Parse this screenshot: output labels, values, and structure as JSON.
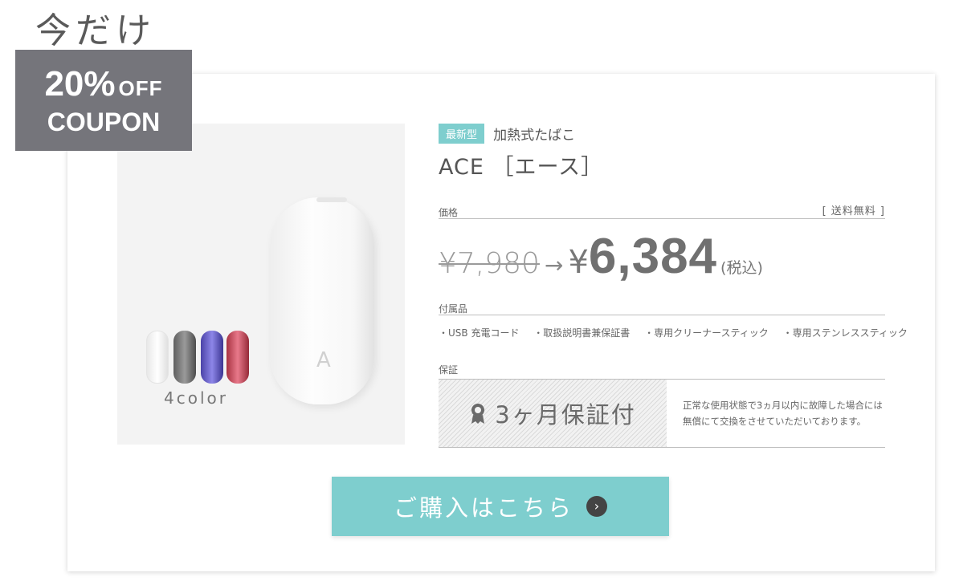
{
  "promo": {
    "label": "今だけ",
    "coupon_percent": "20%",
    "coupon_off": "OFF",
    "coupon_word": "COUPON"
  },
  "product": {
    "new_tag": "最新型",
    "category": "加熱式たばこ",
    "name": "ACE ［エース］",
    "device_logo": "A",
    "color_count_label": "4color",
    "swatch_colors": [
      "#ffffff",
      "#7a7a7a",
      "#6a62d0",
      "#d05060"
    ]
  },
  "price": {
    "section_label": "価格",
    "shipping": "[ 送料無料 ]",
    "old_price": "¥7,980",
    "arrow": "→",
    "yen_symbol": "¥",
    "new_price": "6,384",
    "tax_note": "(税込)"
  },
  "accessories": {
    "section_label": "付属品",
    "items": [
      "・USB 充電コード",
      "・取扱説明書兼保証書",
      "・専用クリーナースティック",
      "・専用ステンレススティック"
    ]
  },
  "warranty": {
    "section_label": "保証",
    "title": "3ヶ月保証付",
    "description_line1": "正常な使用状態で3ヵ月以内に故障した場合には",
    "description_line2": "無償にて交換をさせていただいております。"
  },
  "cta": {
    "label": "ご購入はこちら",
    "chevron": "›"
  },
  "colors": {
    "accent": "#7ecece",
    "badge": "#75757b"
  }
}
